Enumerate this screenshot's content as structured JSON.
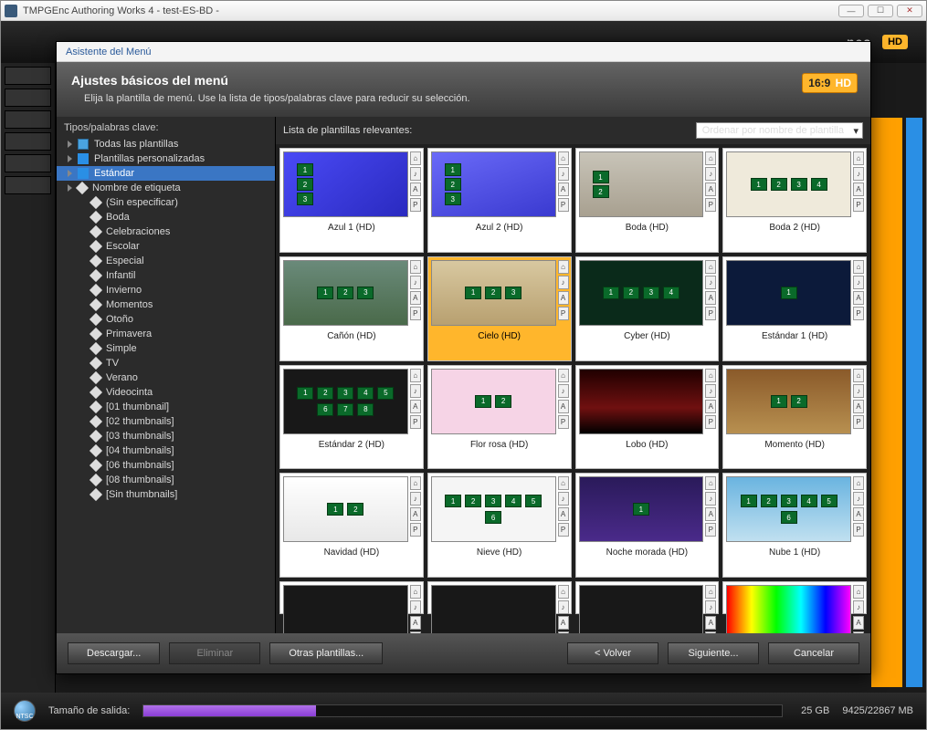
{
  "window": {
    "title": "TMPGEnc Authoring Works 4 - test-ES-BD -"
  },
  "bg": {
    "nes": "nes",
    "hd": "HD"
  },
  "wizard": {
    "title": "Asistente del Menú",
    "heading": "Ajustes básicos del menú",
    "sub": "Elija la plantilla de menú. Use la lista de tipos/palabras clave para reducir su selección.",
    "hd_label": "16:9",
    "hd_suffix": "HD"
  },
  "sidebar": {
    "label": "Tipos/palabras clave:",
    "items": [
      {
        "label": "Todas las plantillas",
        "indent": "item",
        "icon": "folder"
      },
      {
        "label": "Plantillas personalizadas",
        "indent": "item",
        "icon": "blue"
      },
      {
        "label": "Estándar",
        "indent": "item",
        "icon": "blue",
        "selected": true
      },
      {
        "label": "Nombre de etiqueta",
        "indent": "item",
        "icon": "tag"
      },
      {
        "label": "(Sin especificar)",
        "indent": "child",
        "icon": "tag"
      },
      {
        "label": "Boda",
        "indent": "child",
        "icon": "tag"
      },
      {
        "label": "Celebraciones",
        "indent": "child",
        "icon": "tag"
      },
      {
        "label": "Escolar",
        "indent": "child",
        "icon": "tag"
      },
      {
        "label": "Especial",
        "indent": "child",
        "icon": "tag"
      },
      {
        "label": "Infantil",
        "indent": "child",
        "icon": "tag"
      },
      {
        "label": "Invierno",
        "indent": "child",
        "icon": "tag"
      },
      {
        "label": "Momentos",
        "indent": "child",
        "icon": "tag"
      },
      {
        "label": "Otoño",
        "indent": "child",
        "icon": "tag"
      },
      {
        "label": "Primavera",
        "indent": "child",
        "icon": "tag"
      },
      {
        "label": "Simple",
        "indent": "child",
        "icon": "tag"
      },
      {
        "label": "TV",
        "indent": "child",
        "icon": "tag"
      },
      {
        "label": "Verano",
        "indent": "child",
        "icon": "tag"
      },
      {
        "label": "Videocinta",
        "indent": "child",
        "icon": "tag"
      },
      {
        "label": "[01 thumbnail]",
        "indent": "child",
        "icon": "tag"
      },
      {
        "label": "[02 thumbnails]",
        "indent": "child",
        "icon": "tag"
      },
      {
        "label": "[03 thumbnails]",
        "indent": "child",
        "icon": "tag"
      },
      {
        "label": "[04 thumbnails]",
        "indent": "child",
        "icon": "tag"
      },
      {
        "label": "[06 thumbnails]",
        "indent": "child",
        "icon": "tag"
      },
      {
        "label": "[08 thumbnails]",
        "indent": "child",
        "icon": "tag"
      },
      {
        "label": "[Sin thumbnails]",
        "indent": "child",
        "icon": "tag"
      }
    ]
  },
  "content": {
    "label": "Lista de plantillas relevantes:",
    "sort": "Ordenar por nombre de plantilla"
  },
  "side_icons": [
    "⌂",
    "♪",
    "A",
    "P"
  ],
  "templates": [
    {
      "label": "Azul 1 (HD)",
      "bg": "bg-blue1",
      "chips": 3,
      "layout": "col"
    },
    {
      "label": "Azul 2 (HD)",
      "bg": "bg-blue2",
      "chips": 3,
      "layout": "col"
    },
    {
      "label": "Boda (HD)",
      "bg": "bg-hands",
      "chips": 2,
      "layout": "col"
    },
    {
      "label": "Boda 2 (HD)",
      "bg": "bg-cream",
      "chips": 4,
      "layout": "row"
    },
    {
      "label": "Cañón (HD)",
      "bg": "bg-canyon",
      "chips": 3,
      "layout": "row"
    },
    {
      "label": "Cielo (HD)",
      "bg": "bg-sand",
      "chips": 3,
      "layout": "row",
      "selected": true
    },
    {
      "label": "Cyber (HD)",
      "bg": "bg-cyber",
      "chips": 4,
      "layout": "grid"
    },
    {
      "label": "Estándar 1 (HD)",
      "bg": "bg-dnavy",
      "chips": 1,
      "layout": "row"
    },
    {
      "label": "Estándar 2 (HD)",
      "bg": "bg-black",
      "chips": 8,
      "layout": "grid"
    },
    {
      "label": "Flor rosa (HD)",
      "bg": "bg-pink",
      "chips": 2,
      "layout": "row"
    },
    {
      "label": "Lobo (HD)",
      "bg": "bg-wolf",
      "chips": 0,
      "layout": "row"
    },
    {
      "label": "Momento (HD)",
      "bg": "bg-wood",
      "chips": 2,
      "layout": "row"
    },
    {
      "label": "Navidad (HD)",
      "bg": "bg-xmas",
      "chips": 2,
      "layout": "row"
    },
    {
      "label": "Nieve (HD)",
      "bg": "bg-white",
      "chips": 6,
      "layout": "grid"
    },
    {
      "label": "Noche morada (HD)",
      "bg": "bg-purple",
      "chips": 1,
      "layout": "row"
    },
    {
      "label": "Nube 1 (HD)",
      "bg": "bg-sky",
      "chips": 6,
      "layout": "grid"
    },
    {
      "label": "",
      "bg": "bg-black",
      "chips": 0,
      "partial": true
    },
    {
      "label": "",
      "bg": "bg-black",
      "chips": 0,
      "partial": true
    },
    {
      "label": "",
      "bg": "bg-black",
      "chips": 0,
      "partial": true
    },
    {
      "label": "",
      "bg": "bg-rainbow",
      "chips": 0,
      "partial": true
    }
  ],
  "footer": {
    "download": "Descargar...",
    "delete": "Eliminar",
    "other": "Otras plantillas...",
    "back": "<  Volver",
    "next": "Siguiente...",
    "cancel": "Cancelar"
  },
  "status": {
    "ntsc": "NTSC",
    "size_label": "Tamaño de salida:",
    "gb": "25 GB",
    "ratio": "9425/22867 MB"
  }
}
